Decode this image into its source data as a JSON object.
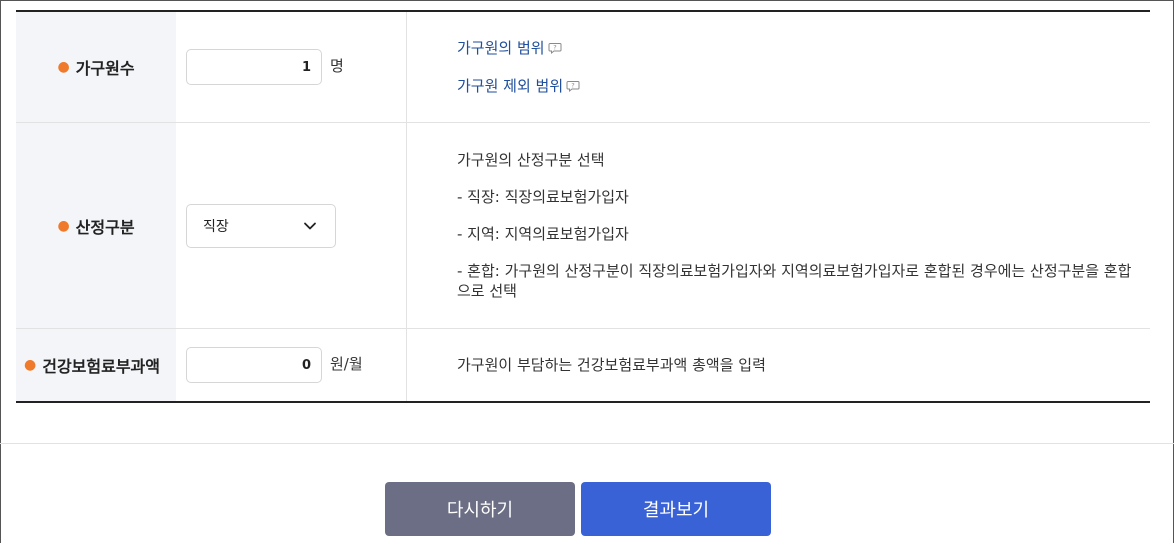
{
  "form": {
    "household": {
      "label": "가구원수",
      "value": "1",
      "unit": "명",
      "links": [
        "가구원의 범위",
        "가구원 제외 범위"
      ]
    },
    "category": {
      "label": "산정구분",
      "selected": "직장",
      "descriptions": [
        "가구원의 산정구분 선택",
        "- 직장: 직장의료보험가입자",
        "- 지역: 지역의료보험가입자",
        "- 혼합: 가구원의 산정구분이 직장의료보험가입자와 지역의료보험가입자로 혼합된 경우에는 산정구분을 혼합으로 선택"
      ]
    },
    "premium": {
      "label": "건강보험료부과액",
      "value": "0",
      "unit": "원/월",
      "description": "가구원이 부담하는 건강보험료부과액 총액을 입력"
    }
  },
  "buttons": {
    "reset_label": "다시하기",
    "result_label": "결과보기"
  },
  "colors": {
    "required_dot": "#f07a2b",
    "link": "#1e4e9c",
    "reset_button": "#6b6e84",
    "result_button": "#3a62d7",
    "label_background": "#f4f5f9"
  },
  "icons": {
    "help": "question-bubble-icon",
    "dropdown": "chevron-down-icon",
    "required": "required-dot-icon"
  }
}
